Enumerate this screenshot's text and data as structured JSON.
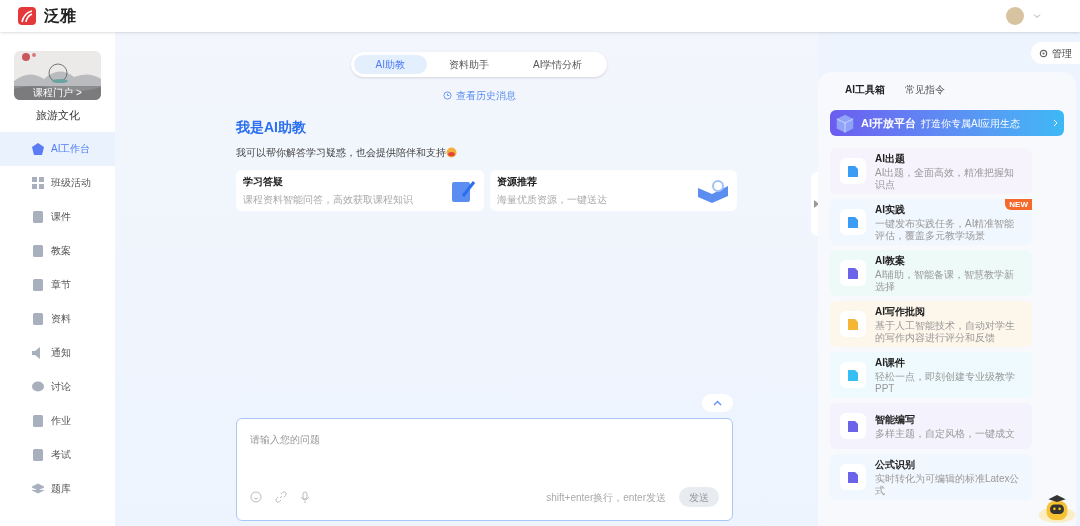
{
  "brand": {
    "name": "泛雅"
  },
  "course": {
    "portal_label": "课程门户 >",
    "title": "旅游文化"
  },
  "sidebar": {
    "items": [
      {
        "label": "AI工作台",
        "selected": true
      },
      {
        "label": "班级活动",
        "selected": false
      },
      {
        "label": "课件",
        "selected": false
      },
      {
        "label": "教案",
        "selected": false
      },
      {
        "label": "章节",
        "selected": false
      },
      {
        "label": "资料",
        "selected": false
      },
      {
        "label": "通知",
        "selected": false
      },
      {
        "label": "讨论",
        "selected": false
      },
      {
        "label": "作业",
        "selected": false
      },
      {
        "label": "考试",
        "selected": false
      },
      {
        "label": "题库",
        "selected": false
      }
    ]
  },
  "tabs": [
    {
      "label": "AI助教",
      "selected": true
    },
    {
      "label": "资料助手",
      "selected": false
    },
    {
      "label": "AI学情分析",
      "selected": false
    }
  ],
  "history_link": "查看历史消息",
  "intro": {
    "title": "我是AI助教",
    "text": "我可以帮你解答学习疑惑，也会提供陪伴和支持"
  },
  "feature_cards": [
    {
      "title": "学习答疑",
      "desc": "课程资料智能问答，高效获取课程知识"
    },
    {
      "title": "资源推荐",
      "desc": "海量优质资源，一键送达"
    }
  ],
  "input": {
    "placeholder": "请输入您的问题",
    "hint": "shift+enter换行，enter发送",
    "send": "发送"
  },
  "manage_button": "管理",
  "panel": {
    "tabs": [
      {
        "label": "AI工具箱",
        "selected": true
      },
      {
        "label": "常见指令",
        "selected": false
      }
    ],
    "banner": {
      "title": "AI开放平台",
      "subtitle": "打造你专属AI应用生态"
    },
    "tools": [
      {
        "name": "AI出题",
        "desc": "AI出题，全面高效，精准把握知识点",
        "color": "#3b9cf5"
      },
      {
        "name": "AI实践",
        "desc": "一键发布实践任务，AI精准智能评估，覆盖多元教学场景",
        "color": "#3b9cf5",
        "badge": "NEW"
      },
      {
        "name": "AI教案",
        "desc": "AI辅助，智能备课，智慧教学新选择",
        "color": "#6b63e8"
      },
      {
        "name": "AI写作批阅",
        "desc": "基于人工智能技术，自动对学生的写作内容进行评分和反馈",
        "color": "#f5b535"
      },
      {
        "name": "AI课件",
        "desc": "轻松一点，即刻创建专业级教学PPT",
        "color": "#36bff5"
      },
      {
        "name": "智能编写",
        "desc": "多样主题，自定风格，一键成文",
        "color": "#6b63e8"
      },
      {
        "name": "公式识别",
        "desc": "实时转化为可编辑的标准Latex公式",
        "color": "#6b63e8"
      }
    ]
  }
}
